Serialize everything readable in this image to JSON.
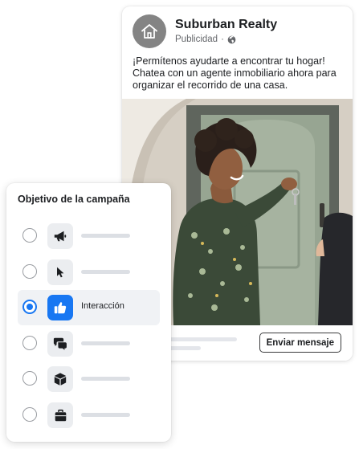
{
  "ad": {
    "page_name": "Suburban Realty",
    "sponsored_label": "Publicidad",
    "separator": "·",
    "body_lines": [
      "¡Permítenos ayudarte a encontrar tu hogar!",
      "Chatea con un agente inmobiliario ahora para",
      "organizar el recorrido de una casa."
    ],
    "cta_label": "Enviar mensaje",
    "icons": {
      "avatar": "house-icon",
      "audience": "globe-icon"
    }
  },
  "objective_panel": {
    "title": "Objetivo de la campaña",
    "options": [
      {
        "icon": "megaphone-icon",
        "selected": false,
        "label": ""
      },
      {
        "icon": "cursor-icon",
        "selected": false,
        "label": ""
      },
      {
        "icon": "thumbs-up-icon",
        "selected": true,
        "label": "Interacción"
      },
      {
        "icon": "chat-bubbles-icon",
        "selected": false,
        "label": ""
      },
      {
        "icon": "cube-icon",
        "selected": false,
        "label": ""
      },
      {
        "icon": "briefcase-icon",
        "selected": false,
        "label": ""
      }
    ]
  },
  "colors": {
    "accent": "#1877f2",
    "text": "#1c1e21",
    "muted": "#65676b",
    "placeholder": "#dcdfe4"
  }
}
